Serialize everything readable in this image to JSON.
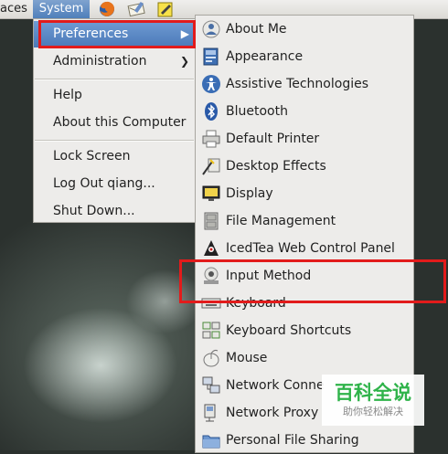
{
  "top_panel": {
    "places_label": "aces",
    "system_label": "System",
    "launchers": [
      "firefox-icon",
      "mail-icon",
      "text-editor-icon"
    ]
  },
  "system_menu": {
    "items": [
      {
        "label": "Preferences",
        "submenu": true,
        "highlighted": true
      },
      {
        "label": "Administration",
        "submenu": true
      },
      {
        "label": "Help"
      },
      {
        "label": "About this Computer"
      },
      {
        "label": "Lock Screen"
      },
      {
        "label": "Log Out qiang..."
      },
      {
        "label": "Shut Down..."
      }
    ]
  },
  "preferences_menu": {
    "items": [
      {
        "label": "About Me",
        "icon": "user-icon"
      },
      {
        "label": "Appearance",
        "icon": "appearance-icon"
      },
      {
        "label": "Assistive Technologies",
        "icon": "accessibility-icon"
      },
      {
        "label": "Bluetooth",
        "icon": "bluetooth-icon"
      },
      {
        "label": "Default Printer",
        "icon": "printer-icon"
      },
      {
        "label": "Desktop Effects",
        "icon": "desktop-effects-icon"
      },
      {
        "label": "Display",
        "icon": "display-icon"
      },
      {
        "label": "File Management",
        "icon": "file-cabinet-icon"
      },
      {
        "label": "IcedTea Web Control Panel",
        "icon": "java-icon"
      },
      {
        "label": "Input Method",
        "icon": "input-method-icon"
      },
      {
        "label": "Keyboard",
        "icon": "keyboard-icon"
      },
      {
        "label": "Keyboard Shortcuts",
        "icon": "shortcuts-icon"
      },
      {
        "label": "Mouse",
        "icon": "mouse-icon"
      },
      {
        "label": "Network Conne",
        "icon": "network-icon"
      },
      {
        "label": "Network Proxy",
        "icon": "proxy-icon"
      },
      {
        "label": "Personal File Sharing",
        "icon": "file-sharing-icon"
      }
    ]
  },
  "watermark": {
    "title": "百科全说",
    "subtitle": "助你轻松解决"
  },
  "colors": {
    "highlight": "#4b79b8",
    "annotation_red": "#e21b1b",
    "watermark_green": "#2fb34a"
  }
}
